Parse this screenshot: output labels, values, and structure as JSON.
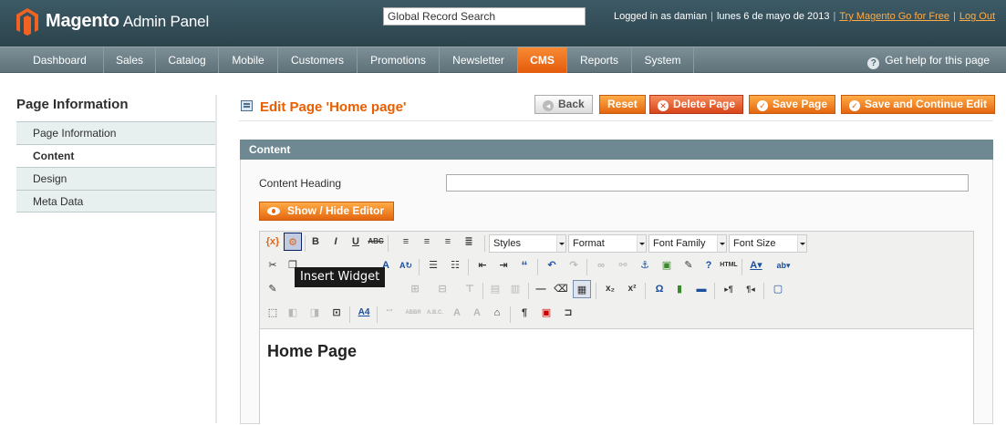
{
  "header": {
    "app_name_bold": "Magento",
    "app_name_light": "Admin Panel",
    "search_value": "Global Record Search",
    "logged_in": "Logged in as damian",
    "date": "lunes 6 de mayo de 2013",
    "try_link": "Try Magento Go for Free",
    "logout": "Log Out"
  },
  "nav": {
    "items": [
      "Dashboard",
      "Sales",
      "Catalog",
      "Mobile",
      "Customers",
      "Promotions",
      "Newsletter",
      "CMS",
      "Reports",
      "System"
    ],
    "active": "CMS",
    "help": "Get help for this page"
  },
  "sidebar": {
    "title": "Page Information",
    "tabs": [
      "Page Information",
      "Content",
      "Design",
      "Meta Data"
    ],
    "active_tab": "Content"
  },
  "page": {
    "title": "Edit Page 'Home page'",
    "buttons": {
      "back": "Back",
      "reset": "Reset",
      "delete": "Delete Page",
      "save": "Save Page",
      "save_continue": "Save and Continue Edit"
    }
  },
  "content": {
    "section_title": "Content",
    "heading_label": "Content Heading",
    "heading_value": "",
    "toggle_editor": "Show / Hide Editor"
  },
  "editor": {
    "selects": [
      "Styles",
      "Format",
      "Font Family",
      "Font Size"
    ],
    "tooltip": "Insert Widget",
    "body_heading": "Home Page"
  }
}
